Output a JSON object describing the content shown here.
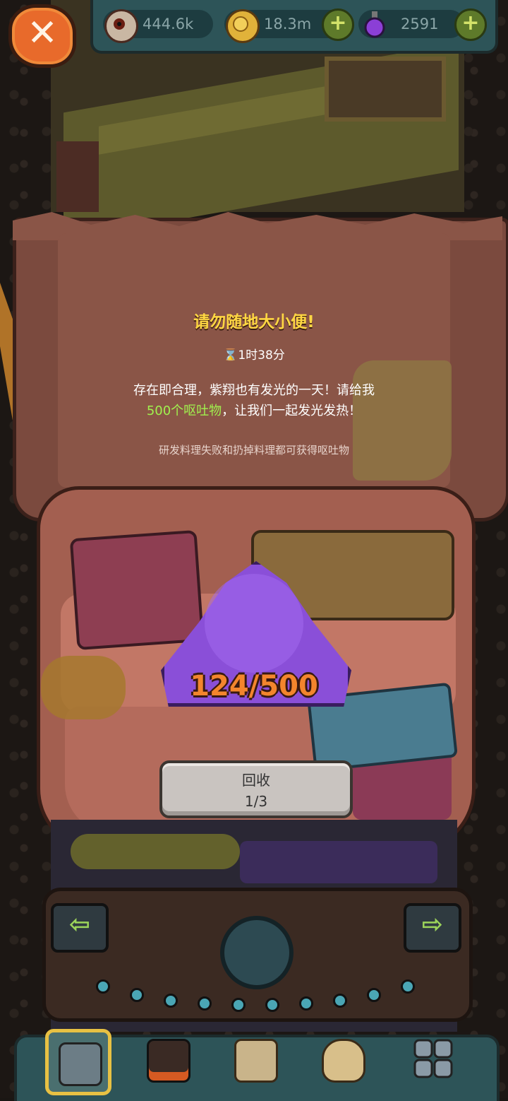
{
  "resources": {
    "eyeballs": "444.6k",
    "coins": "18.3m",
    "potions": "2591",
    "plus": "+"
  },
  "close": {
    "icon": "✕"
  },
  "event": {
    "title": "请勿随地大小便!",
    "timer": "1时38分",
    "desc_line1": "存在即合理，紫翔也有发光的一天！请给我",
    "desc_highlight": "500个呕吐物",
    "desc_rest": "，让我们一起发光发热！",
    "hint": "研发料理失败和扔掉料理都可获得呕吐物"
  },
  "progress": {
    "current": 124,
    "target": 500,
    "text": "124/500"
  },
  "recycle_button": {
    "label": "回收",
    "count": "1/3"
  },
  "nav": {
    "arrow_left": "⇦",
    "arrow_right": "⇨",
    "items": [
      "restaurant",
      "kitchen",
      "recipe-book",
      "money-bag",
      "menu-grid"
    ]
  },
  "colors": {
    "title": "#ffd743",
    "highlight": "#a0f14e",
    "progress": "#f3852d",
    "pile": "#8a4fd8",
    "bar": "#2d5458"
  }
}
